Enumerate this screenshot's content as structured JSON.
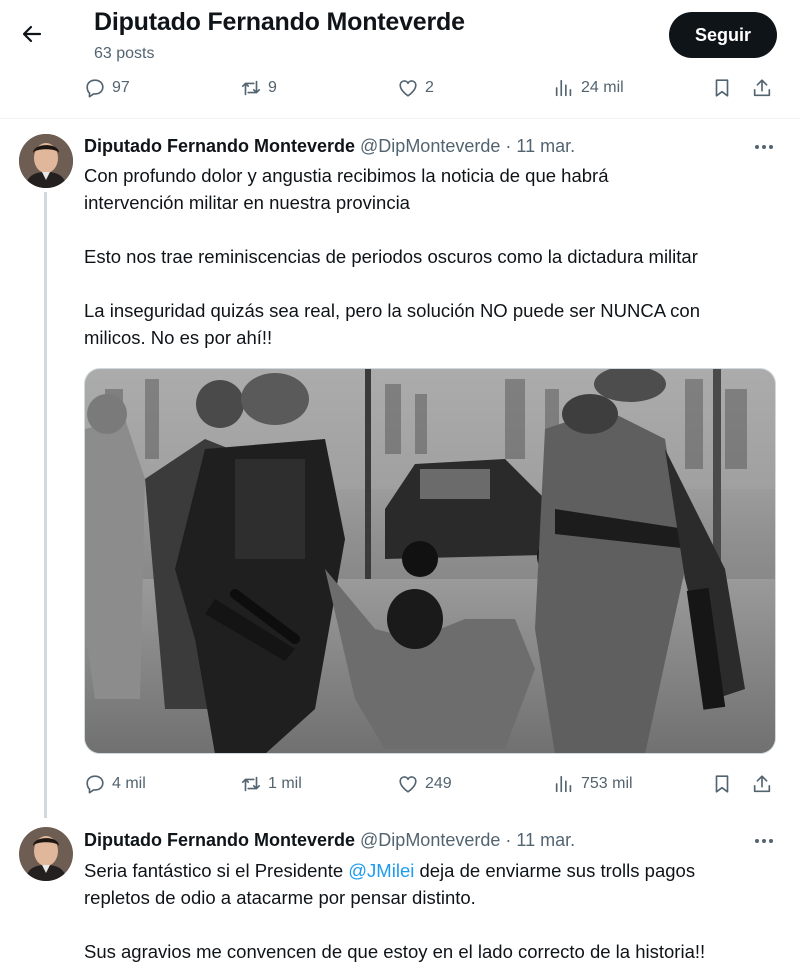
{
  "header": {
    "title": "Diputado Fernando Monteverde",
    "posts_count": "63 posts",
    "follow_label": "Seguir"
  },
  "top_actions": {
    "replies": "97",
    "reposts": "9",
    "likes": "2",
    "views": "24 mil"
  },
  "tweets": [
    {
      "name": "Diputado Fernando Monteverde",
      "handle": "@DipMonteverde",
      "sep": "·",
      "date": "11 mar.",
      "lines": [
        "Con profundo dolor y angustia recibimos la noticia de que habrá",
        "intervención militar en nuestra provincia",
        "Esto nos trae reminiscencias de periodos oscuros como la dictadura militar",
        "La inseguridad quizás sea real, pero la solución NO puede ser NUNCA con",
        "milicos. No es por ahí!!"
      ],
      "actions": {
        "replies": "4 mil",
        "reposts": "1 mil",
        "likes": "249",
        "views": "753 mil"
      }
    },
    {
      "name": "Diputado Fernando Monteverde",
      "handle": "@DipMonteverde",
      "sep": "·",
      "date": "11 mar.",
      "line1_pre": "Seria fantástico si el Presidente ",
      "mention": "@JMilei",
      "line1_post": " deja de enviarme sus trolls pagos",
      "line2": "repletos de odio a atacarme por pensar distinto.",
      "line3": "Sus agravios me convencen de que estoy en el lado correcto de la historia!!"
    }
  ],
  "colors": {
    "text": "#0f1419",
    "secondary": "#536471",
    "link": "#1d9bf0",
    "follow_bg": "#0f1419"
  },
  "icons": [
    "back-arrow-icon",
    "reply-icon",
    "repost-icon",
    "like-icon",
    "views-icon",
    "bookmark-icon",
    "share-icon",
    "more-icon"
  ]
}
